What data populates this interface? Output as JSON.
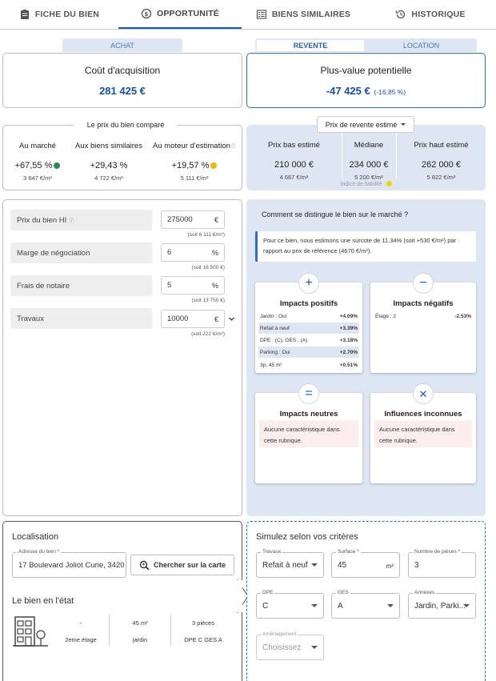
{
  "tabs": [
    {
      "label": "FICHE DU BIEN",
      "icon": "clipboard-icon"
    },
    {
      "label": "OPPORTUNITÉ",
      "icon": "currency-cycle-icon"
    },
    {
      "label": "BIENS SIMILAIRES",
      "icon": "list-icon"
    },
    {
      "label": "HISTORIQUE",
      "icon": "history-icon"
    }
  ],
  "segments": {
    "achat": "ACHAT",
    "revente": "REVENTE",
    "location": "LOCATION"
  },
  "acquisition": {
    "title": "Coût d'acquisition",
    "value": "281 425 €"
  },
  "plusvalue": {
    "title": "Plus-value potentielle",
    "value": "-47 425 €",
    "pct": "(-16,85 %)"
  },
  "compare": {
    "title": "Le prix du bien comparé",
    "cols": [
      {
        "label": "Au marché",
        "value": "+67,55 %",
        "sub": "3 647 €/m²",
        "dot": "#2e8b57"
      },
      {
        "label": "Aux biens similaires",
        "value": "+29,43 %",
        "sub": "4 722 €/m²"
      },
      {
        "label": "Au moteur d'estimation",
        "value": "+19,57 %",
        "sub": "5 111 €/m²",
        "dot": "#f2b705"
      }
    ]
  },
  "revente": {
    "dropdown": "Prix de revente estimé",
    "cols": [
      {
        "label": "Prix bas estimé",
        "value": "210 000 €",
        "sub": "4 667 €/m²"
      },
      {
        "label": "Médiane",
        "value": "234 000 €",
        "sub": "5 200 €/m²"
      },
      {
        "label": "Prix haut estimé",
        "value": "262 000 €",
        "sub": "5 822 €/m²"
      }
    ],
    "fiabilite": "Indice de fiabilité",
    "fiabilite_color": "#f2d500"
  },
  "form": {
    "fields": [
      {
        "label": "Prix du bien HI",
        "value": "275000",
        "unit": "€",
        "sub": "(soit 6 111 €/m²)"
      },
      {
        "label": "Marge de négociation",
        "value": "6",
        "unit": "%",
        "sub": "(soit 16 500 €)"
      },
      {
        "label": "Frais de notaire",
        "value": "5",
        "unit": "%",
        "sub": "(soit 13 750 €)"
      },
      {
        "label": "Travaux",
        "value": "10000",
        "unit": "€",
        "sub": "(soit 222 €/m²)"
      }
    ]
  },
  "market": {
    "title": "Comment se distingue le bien sur le marché ?",
    "note": "Pour ce bien, nous estimons une surcote de 11.34% (soit +530 €/m²) par rapport au prix de référence (4670 €/m²).",
    "positifs": {
      "title": "Impacts positifs",
      "rows": [
        {
          "label": "Jardin : Oui",
          "value": "+4.09%"
        },
        {
          "label": "Refait à neuf",
          "value": "+3.39%"
        },
        {
          "label": "DPE : (C), GES : (A)",
          "value": "+3.18%"
        },
        {
          "label": "Parking : Oui",
          "value": "+2.70%"
        },
        {
          "label": "3p, 45 m²",
          "value": "+0.51%"
        }
      ]
    },
    "negatifs": {
      "title": "Impacts négatifs",
      "rows": [
        {
          "label": "Étage : 2",
          "value": "-2.53%"
        }
      ]
    },
    "neutres": {
      "title": "Impacts neutres",
      "empty": "Aucune caractéristique dans cette rubrique."
    },
    "inconnues": {
      "title": "Influences inconnues",
      "empty": "Aucune caractéristique dans cette rubrique."
    }
  },
  "localisation": {
    "title": "Localisation",
    "address_label": "Adresse du bien *",
    "address": "17 Boulevard Joliot Curie, 3420",
    "search_btn": "Chercher sur la carte"
  },
  "etat": {
    "title": "Le bien en l'état",
    "cells": [
      "-",
      "45 m²",
      "3 pièces",
      "2eme étage",
      "jardin",
      "DPE C  GES A"
    ]
  },
  "simulez": {
    "title": "Simulez selon vos critères",
    "travaux": {
      "label": "Travaux",
      "value": "Refait à neuf"
    },
    "surface": {
      "label": "Surface *",
      "value": "45",
      "unit": "m²"
    },
    "pieces": {
      "label": "Nombre de pièces *",
      "value": "3"
    },
    "dpe": {
      "label": "DPE",
      "value": "C"
    },
    "ges": {
      "label": "GES",
      "value": "A"
    },
    "annexes": {
      "label": "Annexes",
      "value": "Jardin, Parki..."
    },
    "amenagement": {
      "label": "Aménagement",
      "placeholder": "Choisissez"
    }
  }
}
